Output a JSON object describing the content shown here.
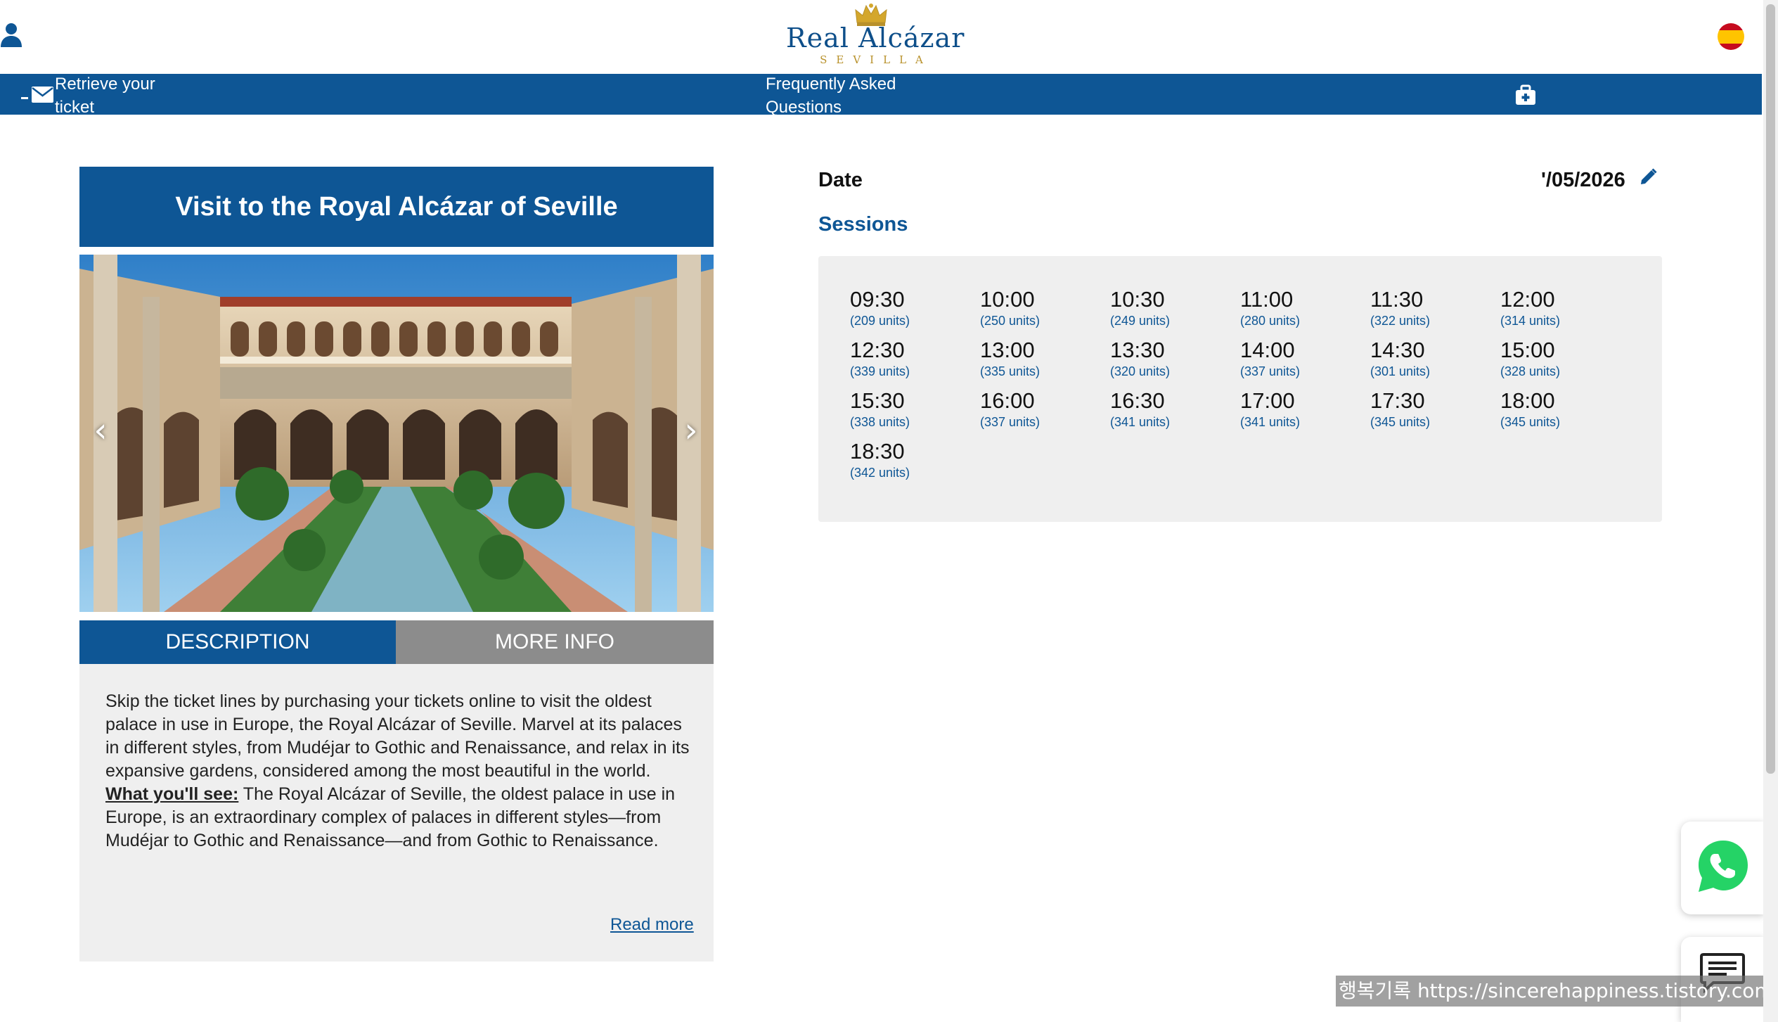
{
  "header": {
    "logo_main": "Real Alcázar",
    "logo_sub": "SEVILLA",
    "language": "es"
  },
  "nav": {
    "retrieve_label": "Retrieve your ticket",
    "faq_label": "Frequently Asked Questions"
  },
  "product": {
    "title": "Visit to the Royal Alcázar of Seville",
    "gallery_prev": "‹",
    "gallery_next": "›",
    "tabs": [
      "DESCRIPTION",
      "MORE INFO"
    ],
    "description": {
      "paragraph": "Skip the ticket lines by purchasing your tickets online to visit the oldest palace in use in Europe, the Royal Alcázar of Seville. Marvel at its palaces in different styles, from Mudéjar to Gothic and Renaissance, and relax in its expansive gardens, considered among the most beautiful in the world.",
      "what_label": "What you'll see:",
      "what_text": " The Royal Alcázar of Seville, the oldest palace in use in Europe, is an extraordinary complex of palaces in different styles—from Mudéjar to Gothic and Renaissance—and from Gothic to Renaissance.",
      "read_more": "Read more"
    }
  },
  "booking": {
    "date_label": "Date",
    "date_value": "'/05/2026",
    "sessions_label": "Sessions",
    "sessions": [
      {
        "time": "09:30",
        "units": "(209 units)"
      },
      {
        "time": "10:00",
        "units": "(250 units)"
      },
      {
        "time": "10:30",
        "units": "(249 units)"
      },
      {
        "time": "11:00",
        "units": "(280 units)"
      },
      {
        "time": "11:30",
        "units": "(322 units)"
      },
      {
        "time": "12:00",
        "units": "(314 units)"
      },
      {
        "time": "12:30",
        "units": "(339 units)"
      },
      {
        "time": "13:00",
        "units": "(335 units)"
      },
      {
        "time": "13:30",
        "units": "(320 units)"
      },
      {
        "time": "14:00",
        "units": "(337 units)"
      },
      {
        "time": "14:30",
        "units": "(301 units)"
      },
      {
        "time": "15:00",
        "units": "(328 units)"
      },
      {
        "time": "15:30",
        "units": "(338 units)"
      },
      {
        "time": "16:00",
        "units": "(337 units)"
      },
      {
        "time": "16:30",
        "units": "(341 units)"
      },
      {
        "time": "17:00",
        "units": "(341 units)"
      },
      {
        "time": "17:30",
        "units": "(345 units)"
      },
      {
        "time": "18:00",
        "units": "(345 units)"
      },
      {
        "time": "18:30",
        "units": "(342 units)"
      }
    ]
  },
  "watermark": "행복기록 https://sincerehappiness.tistory.com",
  "icons": {
    "user": "user-icon",
    "mail": "mail-icon",
    "bag": "briefcase-icon",
    "pencil": "pencil-icon",
    "whatsapp": "whatsapp-icon",
    "chat": "chat-icon"
  },
  "colors": {
    "brand_blue": "#0e5695",
    "tab_inactive": "#8c8c8c",
    "panel_bg": "#efefef",
    "whatsapp_green": "#25d366"
  }
}
